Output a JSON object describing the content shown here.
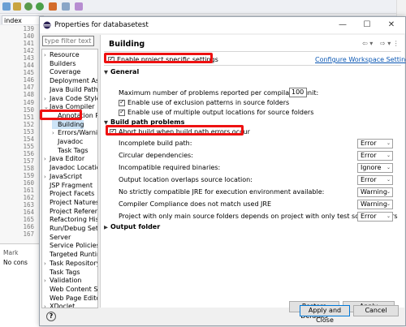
{
  "ide": {
    "editor_tab": "index",
    "line_numbers": [
      "139",
      "140",
      "141",
      "142",
      "143",
      "144",
      "145",
      "146",
      "147",
      "148",
      "149",
      "150",
      "151",
      "152",
      "153",
      "154",
      "155",
      "156",
      "157",
      "158",
      "159",
      "160",
      "161",
      "162",
      "163",
      "164",
      "165",
      "166",
      "167"
    ],
    "bottom_tab": "Mark",
    "bottom_text": "No cons",
    "right_strip": [
      "C",
      "B"
    ]
  },
  "dialog": {
    "title": "Properties for databasetest",
    "filter_placeholder": "type filter text",
    "tree": [
      {
        "label": "Resource",
        "arrow": "›"
      },
      {
        "label": "Builders",
        "arrow": ""
      },
      {
        "label": "Coverage",
        "arrow": ""
      },
      {
        "label": "Deployment Ass",
        "arrow": ""
      },
      {
        "label": "Java Build Path",
        "arrow": ""
      },
      {
        "label": "Java Code Style",
        "arrow": "›"
      },
      {
        "label": "Java Compiler",
        "arrow": "⌄"
      },
      {
        "label": "Annotation Pr",
        "arrow": ""
      },
      {
        "label": "Building",
        "arrow": ""
      },
      {
        "label": "Errors/Warnin",
        "arrow": "›"
      },
      {
        "label": "Javadoc",
        "arrow": ""
      },
      {
        "label": "Task Tags",
        "arrow": ""
      },
      {
        "label": "Java Editor",
        "arrow": "›"
      },
      {
        "label": "Javadoc Location",
        "arrow": ""
      },
      {
        "label": "JavaScript",
        "arrow": "›"
      },
      {
        "label": "JSP Fragment",
        "arrow": ""
      },
      {
        "label": "Project Facets",
        "arrow": ""
      },
      {
        "label": "Project Natures",
        "arrow": ""
      },
      {
        "label": "Project Referenc",
        "arrow": ""
      },
      {
        "label": "Refactoring Histo",
        "arrow": ""
      },
      {
        "label": "Run/Debug Setti",
        "arrow": ""
      },
      {
        "label": "Server",
        "arrow": ""
      },
      {
        "label": "Service Policies",
        "arrow": ""
      },
      {
        "label": "Targeted Runtim",
        "arrow": ""
      },
      {
        "label": "Task Repository",
        "arrow": "›"
      },
      {
        "label": "Task Tags",
        "arrow": ""
      },
      {
        "label": "Validation",
        "arrow": "›"
      },
      {
        "label": "Web Content Se",
        "arrow": ""
      },
      {
        "label": "Web Page Editor",
        "arrow": ""
      },
      {
        "label": "XDoclet",
        "arrow": "›"
      }
    ],
    "page_title": "Building",
    "enable_specific": "Enable project specific settings",
    "configure_link": "Configure Workspace Settings...",
    "general": {
      "header": "General",
      "max_problems_label": "Maximum number of problems reported per compilation unit:",
      "max_problems_value": "100",
      "exclusion_label": "Enable use of exclusion patterns in source folders",
      "multiple_output_label": "Enable use of multiple output locations for source folders"
    },
    "build_path": {
      "header": "Build path problems",
      "abort_label": "Abort build when build path errors occur",
      "rows": [
        {
          "label": "Incomplete build path:",
          "value": "Error"
        },
        {
          "label": "Circular dependencies:",
          "value": "Error"
        },
        {
          "label": "Incompatible required binaries:",
          "value": "Ignore"
        },
        {
          "label": "Output location overlaps source location:",
          "value": "Error"
        },
        {
          "label": "No strictly compatible JRE for execution environment available:",
          "value": "Warning"
        },
        {
          "label": "Compiler Compliance does not match used JRE",
          "value": "Warning"
        },
        {
          "label": "Project with only main source folders depends on project with only test source folders",
          "value": "Error"
        }
      ]
    },
    "output_folder": "Output folder",
    "restore_defaults": "Restore Defaults",
    "apply": "Apply",
    "apply_close": "Apply and Close",
    "cancel": "Cancel"
  },
  "colors": {
    "highlight": "#ee1111",
    "link": "#0b57b3",
    "selection": "#cce4f7"
  }
}
